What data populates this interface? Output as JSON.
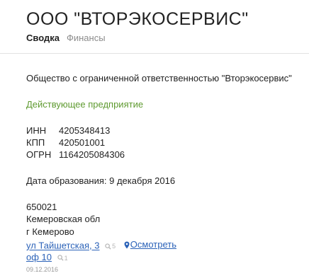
{
  "header": {
    "title": "ООО \"ВТОРЭКОСЕРВИС\"",
    "tabs": [
      {
        "label": "Сводка",
        "active": true
      },
      {
        "label": "Финансы",
        "active": false
      }
    ]
  },
  "company": {
    "full_name": "Общество с ограниченной ответственностью \"Вторэкосервис\"",
    "status": "Действующее предприятие",
    "requisites": [
      {
        "label": "ИНН",
        "value": "4205348413"
      },
      {
        "label": "КПП",
        "value": "420501001"
      },
      {
        "label": "ОГРН",
        "value": "1164205084306"
      }
    ],
    "founded": "Дата образования: 9 декабря 2016"
  },
  "address": {
    "postcode": "650021",
    "region": "Кемеровская обл",
    "city": "г Кемерово",
    "street": "ул Тайшетская, 3",
    "street_count": "5",
    "view_label": "Осмотреть",
    "office": "оф 10",
    "office_count": "1",
    "updated": "09.12.2016"
  },
  "colors": {
    "status_green": "#5e9a2f",
    "link_blue": "#2b62b8",
    "muted_gray": "#8c8c8c"
  },
  "icons": {
    "search": "search-icon",
    "pin": "map-pin-icon"
  }
}
